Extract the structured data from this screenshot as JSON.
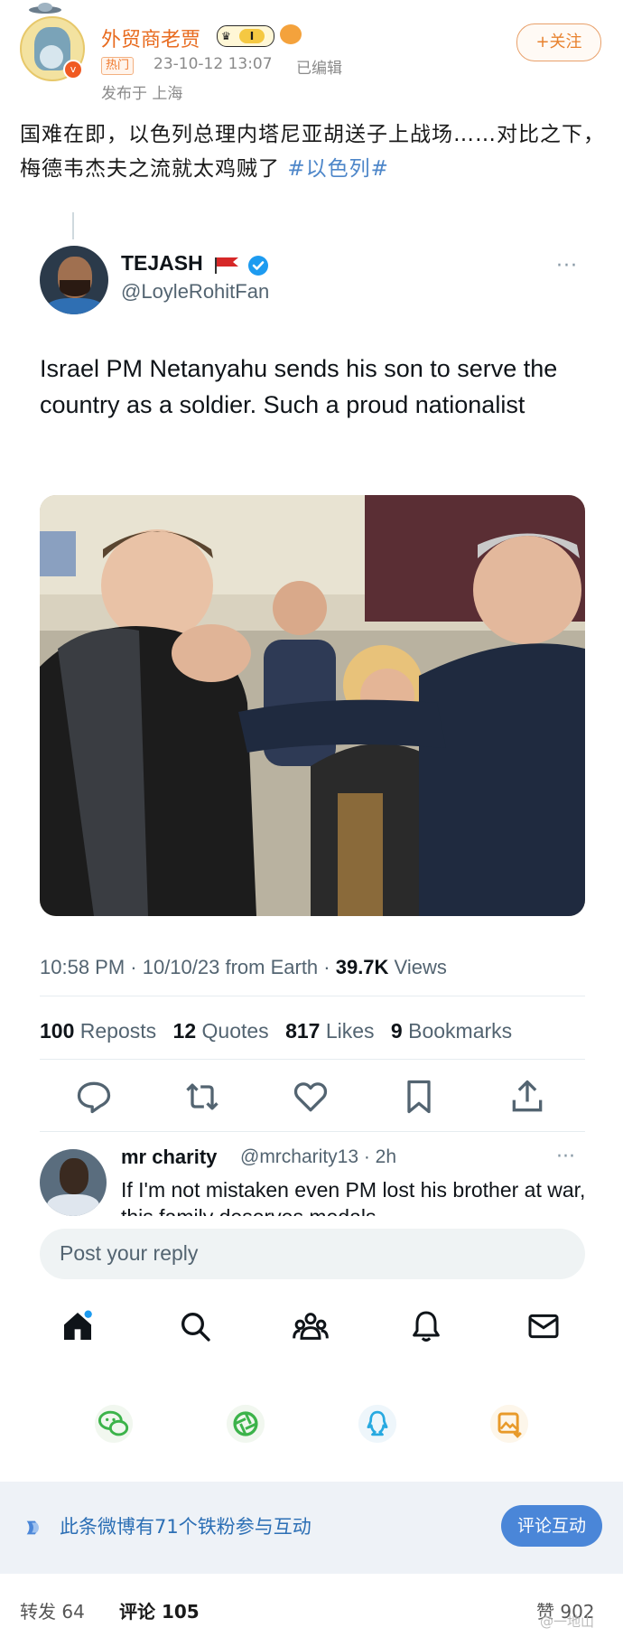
{
  "weibo": {
    "user_name": "外贸商老贾",
    "level_badge": "I",
    "hot_tag": "热门",
    "post_time": "23-10-12 13:07",
    "edited": "已编辑",
    "publish_location": "发布于 上海",
    "follow_label": "+关注",
    "post_text": "国难在即，以色列总理内塔尼亚胡送子上战场……对比之下，梅德韦杰夫之流就太鸡贼了 ",
    "hashtag": "#以色列#",
    "fan_text": "此条微博有71个铁粉参与互动",
    "comment_interact_label": "评论互动",
    "tabs": {
      "repost": "转发 64",
      "comment": "评论 105",
      "like": "赞 902"
    },
    "watermark": "@一地山"
  },
  "tweet": {
    "author_name": "TEJASH",
    "author_handle": "@LoyleRohitFan",
    "more": "···",
    "text": "Israel PM Netanyahu sends his son to serve the country as a soldier. Such a proud nationalist",
    "meta_prefix": "10:58 PM · 10/10/23 from Earth · ",
    "views_count": "39.7K",
    "views_label": " Views",
    "stats": {
      "reposts_count": "100",
      "reposts_label": " Reposts",
      "quotes_count": "12",
      "quotes_label": " Quotes",
      "likes_count": "817",
      "likes_label": " Likes",
      "bookmarks_count": "9",
      "bookmarks_label": " Bookmarks"
    },
    "colors": {
      "verified": "#1d9bf0",
      "flag": "#d62828"
    }
  },
  "reply": {
    "name": "mr charity",
    "handle": "@mrcharity13 · 2h",
    "more": "···",
    "text": "If I'm not mistaken even PM lost his brother at war, this family deserves medals",
    "placeholder": "Post your reply"
  }
}
